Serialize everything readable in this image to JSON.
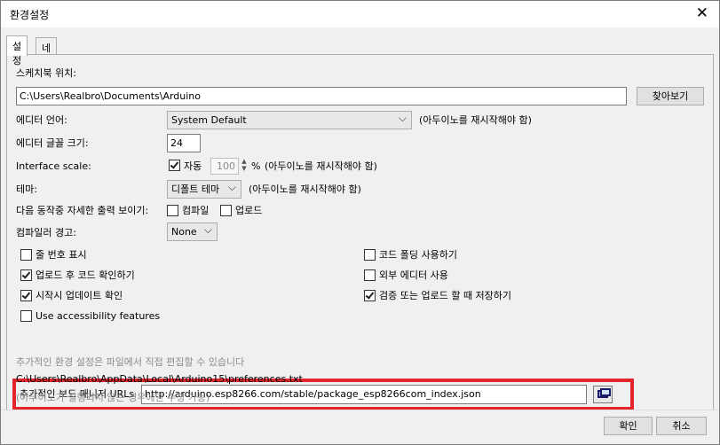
{
  "window": {
    "title": "환경설정",
    "close_glyph": "✕"
  },
  "tabs": [
    {
      "label": "설정",
      "active": true
    },
    {
      "label": "네트워크",
      "active": false
    }
  ],
  "settings": {
    "sketchbook_label": "스케치북 위치:",
    "sketchbook_path": "C:\\Users\\Realbro\\Documents\\Arduino",
    "browse_label": "찾아보기",
    "editor_lang_label": "에디터 언어:",
    "editor_lang_value": "System Default",
    "editor_lang_note": "(아두이노를 재시작해야 함)",
    "font_size_label": "에디터 글꼴 크기:",
    "font_size_value": "24",
    "scale_label": "Interface scale:",
    "scale_auto_label": "자동",
    "scale_value": "100",
    "scale_unit": "%",
    "scale_note": "(아두이노를 재시작해야 함)",
    "theme_label": "테마:",
    "theme_value": "디폴트 테마",
    "theme_note": "(아두이노를 재시작해야 함)",
    "verbose_label": "다음 동작중 자세한 출력 보이기:",
    "verbose_compile_label": "컴파일",
    "verbose_upload_label": "업로드",
    "compiler_warn_label": "컴파일러 경고:",
    "compiler_warn_value": "None",
    "options": [
      {
        "label": "줄 번호 표시",
        "checked": false
      },
      {
        "label": "코드 폴딩 사용하기",
        "checked": false
      },
      {
        "label": "업로드 후 코드 확인하기",
        "checked": true
      },
      {
        "label": "외부 에디터 사용",
        "checked": false
      },
      {
        "label": "시작시 업데이트 확인",
        "checked": true
      },
      {
        "label": "검증 또는 업로드 할 때 저장하기",
        "checked": true
      },
      {
        "label": "Use accessibility features",
        "checked": false
      }
    ],
    "board_urls_label": "추가적인 보드 매니저 URLs",
    "board_urls_value": "http://arduino.esp8266.com/stable/package_esp8266com_index.json",
    "more_prefs_note": "추가적인 환경 설정은 파일에서 직접 편집할 수 있습니다",
    "prefs_path": "C:\\Users\\Realbro\\AppData\\Local\\Arduino15\\preferences.txt",
    "prefs_edit_note": "(아두이노가 실행되지 않는 경우에만 수정 가능)"
  },
  "footer": {
    "ok_label": "확인",
    "cancel_label": "취소"
  },
  "colors": {
    "highlight": "#e3262c"
  }
}
